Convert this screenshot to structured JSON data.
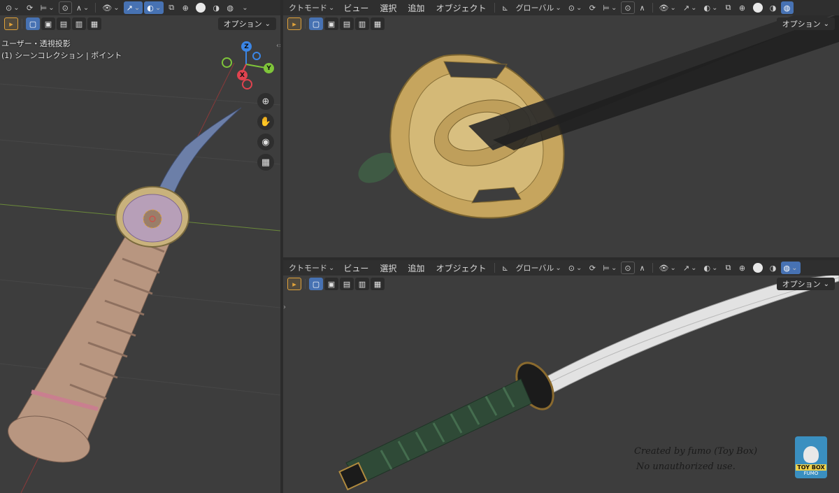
{
  "left_view": {
    "overlay_line1": "ユーザー・透視投影",
    "overlay_line2": "(1) シーンコレクション | ポイント",
    "options_label": "オプション",
    "gizmo": {
      "z": "Z",
      "y": "Y",
      "x": "X"
    }
  },
  "top_view": {
    "header": {
      "mode_label": "クトモード",
      "menu_view": "ビュー",
      "menu_select": "選択",
      "menu_add": "追加",
      "menu_object": "オブジェクト",
      "transform_orientation": "グローバル"
    },
    "options_label": "オプション"
  },
  "bottom_view": {
    "header": {
      "mode_label": "クトモード",
      "menu_view": "ビュー",
      "menu_select": "選択",
      "menu_add": "追加",
      "menu_object": "オブジェクト",
      "transform_orientation": "グローバル"
    },
    "options_label": "オプション",
    "credit_line1": "Created by fumo (Toy Box)",
    "credit_line2": "No unauthorized use.",
    "logo_text_top": "TOY BOX",
    "logo_text_bottom": "FUMO"
  },
  "colors": {
    "viewport_bg": "#3d3d3d",
    "header_bg": "#2f2f2f",
    "active_blue": "#4772b3",
    "select_orange": "#e0a23a",
    "axis_x": "#e0434f",
    "axis_y": "#7fc53a",
    "axis_z": "#3b86e6"
  }
}
